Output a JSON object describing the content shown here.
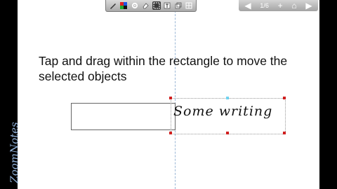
{
  "app": {
    "watermark": "ZoomNotes"
  },
  "toolbar": {
    "items": [
      {
        "name": "pen-tool-icon",
        "glyph": "✎"
      },
      {
        "name": "color-palette-icon",
        "glyph": ""
      },
      {
        "name": "gear-icon",
        "glyph": "⚙"
      },
      {
        "name": "eraser-icon",
        "glyph": "⌫"
      },
      {
        "name": "selection-tool-icon",
        "glyph": "▦"
      },
      {
        "name": "text-tool-icon",
        "glyph": "T"
      },
      {
        "name": "copy-icon",
        "glyph": "⧉"
      },
      {
        "name": "grid-icon",
        "glyph": "▤"
      }
    ],
    "active_index": 4
  },
  "nav": {
    "back_glyph": "◀",
    "page_label": "1/6",
    "add_glyph": "+",
    "home_glyph": "⌂",
    "forward_glyph": "▶"
  },
  "page": {
    "instruction": "Tap and drag within the rectangle to move the selected objects",
    "handwriting": "Some writing"
  },
  "colors": {
    "handle": "#d01e1e",
    "rotation_handle": "#6fd3f0",
    "guide_line": "#9bb7d6"
  }
}
